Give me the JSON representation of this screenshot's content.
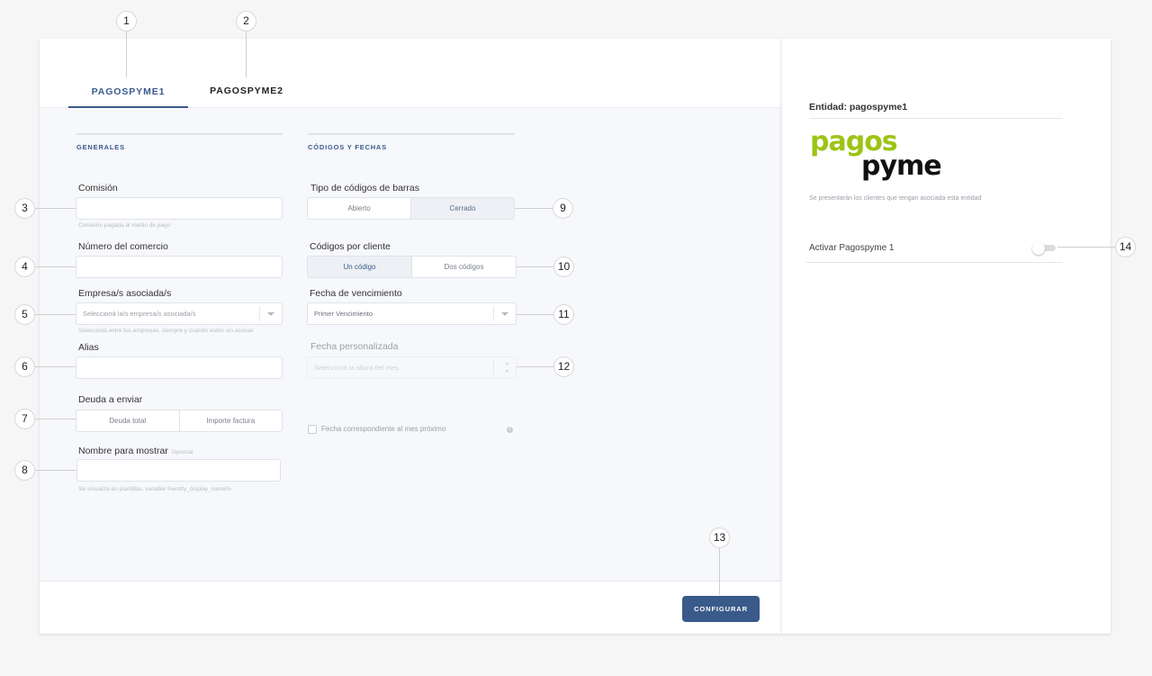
{
  "tabs": [
    {
      "label": "PAGOSPYME1",
      "active": true
    },
    {
      "label": "PAGOSPYME2",
      "active": false
    }
  ],
  "sections": {
    "generales": "GENERALES",
    "codigos": "CÓDIGOS Y FECHAS"
  },
  "fields": {
    "comision": {
      "label": "Comisión",
      "hint": "Comisión pagada al medio de pago"
    },
    "numero_comercio": {
      "label": "Número del comercio"
    },
    "empresas": {
      "label": "Empresa/s asociada/s",
      "placeholder": "Seleccioná la/s empresa/s asociada/s",
      "hint": "Seleccioná entre tus empresas, siempre y cuando estén sin asociar"
    },
    "alias": {
      "label": "Alias"
    },
    "deuda": {
      "label": "Deuda a enviar",
      "options": [
        "Deuda total",
        "Importe factura"
      ]
    },
    "nombre_mostrar": {
      "label": "Nombre para mostrar",
      "optional": "Opcional",
      "hint": "Se visualiza en plantillas, variable %entity_display_name%"
    },
    "tipo_codigos": {
      "label": "Tipo de códigos de barras",
      "options": [
        "Abierto",
        "Cerrado"
      ],
      "selected": "Cerrado"
    },
    "codigos_cliente": {
      "label": "Códigos por cliente",
      "options": [
        "Un código",
        "Dos códigos"
      ],
      "selected": "Un código"
    },
    "fecha_venc": {
      "label": "Fecha de vencimiento",
      "value": "Primer Vencimiento"
    },
    "fecha_pers": {
      "label": "Fecha personalizada",
      "placeholder": "Seleccioná la altura del mes"
    },
    "mes_proximo": {
      "label": "Fecha correspondiente al mes próximo"
    }
  },
  "footer": {
    "configure_label": "CONFIGURAR"
  },
  "side": {
    "title": "Entidad: pagospyme1",
    "logo_top": "pagos",
    "logo_bottom": "pyme",
    "description": "Se presentarán los clientes que tengan asociada esta entidad",
    "toggle_label": "Activar Pagospyme 1",
    "toggle_on": false
  },
  "callouts": [
    "1",
    "2",
    "3",
    "4",
    "5",
    "6",
    "7",
    "8",
    "9",
    "10",
    "11",
    "12",
    "13",
    "14"
  ],
  "colors": {
    "accent": "#3a5a8a",
    "logo_green": "#9cc414",
    "background": "#f6f6f6"
  },
  "icons": [
    "caret-down-icon",
    "spinner-arrows-icon",
    "info-icon"
  ]
}
